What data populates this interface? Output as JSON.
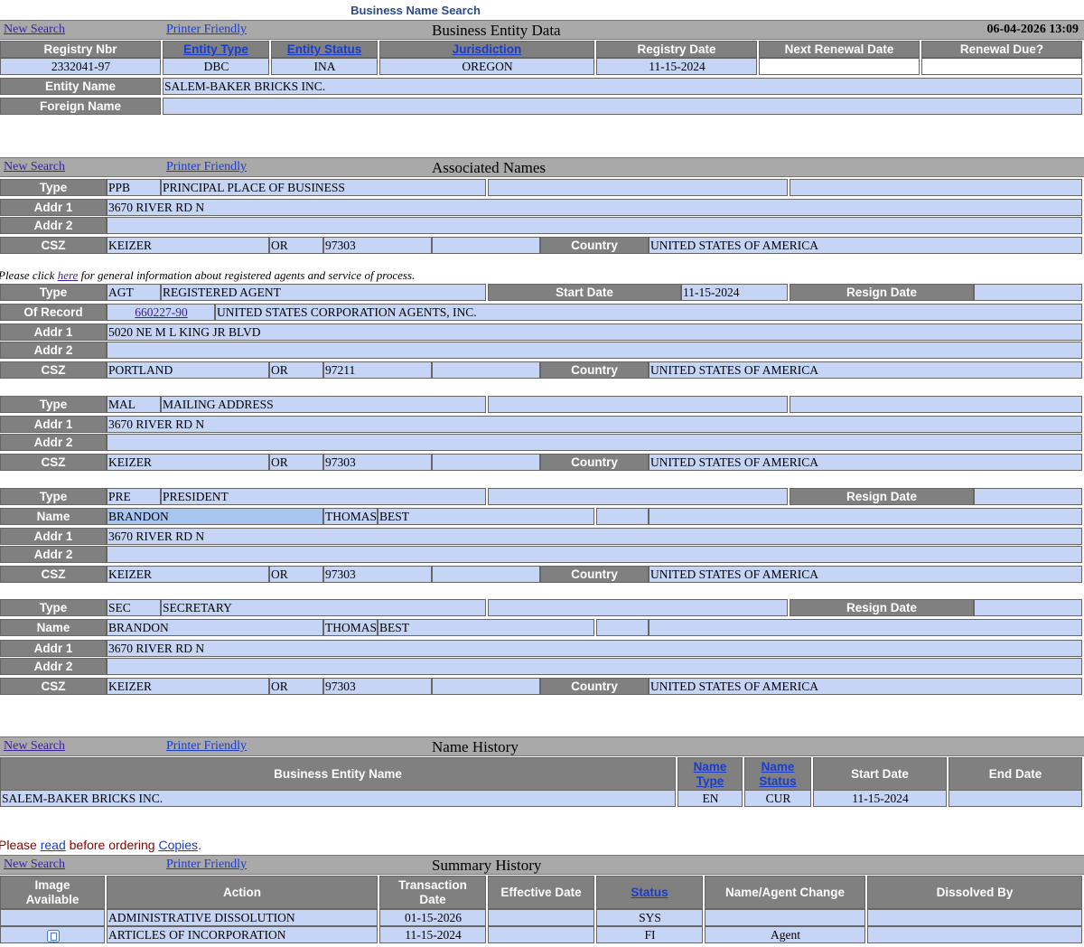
{
  "top_link": "Business Name Search",
  "common": {
    "new_search": "New Search",
    "printer_friendly": "Printer Friendly"
  },
  "entity": {
    "title": "Business Entity Data",
    "timestamp": "06-04-2026 13:09",
    "headers": [
      "Registry Nbr",
      "Entity Type",
      "Entity Status",
      "Jurisdiction",
      "Registry Date",
      "Next Renewal Date",
      "Renewal Due?"
    ],
    "values": [
      "2332041-97",
      "DBC",
      "INA",
      "OREGON",
      "11-15-2024",
      "",
      ""
    ],
    "entity_name_label": "Entity Name",
    "entity_name": "SALEM-BAKER BRICKS INC.",
    "foreign_name_label": "Foreign Name",
    "foreign_name": ""
  },
  "labels": {
    "type": "Type",
    "addr1": "Addr 1",
    "addr2": "Addr 2",
    "csz": "CSZ",
    "country": "Country",
    "of_record": "Of Record",
    "start_date": "Start Date",
    "resign_date": "Resign Date",
    "name": "Name"
  },
  "associated": {
    "title": "Associated Names",
    "ppb": {
      "code": "PPB",
      "desc": "PRINCIPAL PLACE OF BUSINESS",
      "addr1": "3670 RIVER RD N",
      "addr2": "",
      "city": "KEIZER",
      "state": "OR",
      "zip": "97303",
      "country": "UNITED STATES OF AMERICA"
    },
    "agent_note": {
      "pre": "Please click ",
      "link": "here",
      "post": " for general information about registered agents and service of process."
    },
    "agt": {
      "code": "AGT",
      "desc": "REGISTERED AGENT",
      "start_date": "11-15-2024",
      "resign_date": "",
      "record_nbr": "660227-90",
      "record_name": "UNITED STATES CORPORATION AGENTS, INC.",
      "addr1": "5020 NE M L KING JR BLVD",
      "addr2": "",
      "city": "PORTLAND",
      "state": "OR",
      "zip": "97211",
      "country": "UNITED STATES OF AMERICA"
    },
    "mal": {
      "code": "MAL",
      "desc": "MAILING ADDRESS",
      "addr1": "3670 RIVER RD N",
      "addr2": "",
      "city": "KEIZER",
      "state": "OR",
      "zip": "97303",
      "country": "UNITED STATES OF AMERICA"
    },
    "pre": {
      "code": "PRE",
      "desc": "PRESIDENT",
      "first": "BRANDON",
      "middle": "THOMAS",
      "last": "BEST",
      "addr1": "3670 RIVER RD N",
      "addr2": "",
      "city": "KEIZER",
      "state": "OR",
      "zip": "97303",
      "country": "UNITED STATES OF AMERICA"
    },
    "sec": {
      "code": "SEC",
      "desc": "SECRETARY",
      "first": "BRANDON",
      "middle": "THOMAS",
      "last": "BEST",
      "addr1": "3670 RIVER RD N",
      "addr2": "",
      "city": "KEIZER",
      "state": "OR",
      "zip": "97303",
      "country": "UNITED STATES OF AMERICA"
    }
  },
  "name_history": {
    "title": "Name History",
    "headers": [
      "Business Entity Name",
      "Name Type",
      "Name Status",
      "Start Date",
      "End Date"
    ],
    "header_name_type": [
      "Name",
      "Type"
    ],
    "header_name_status": [
      "Name",
      "Status"
    ],
    "rows": [
      {
        "name": "SALEM-BAKER BRICKS INC.",
        "type": "EN",
        "status": "CUR",
        "start": "11-15-2024",
        "end": ""
      }
    ]
  },
  "copies_note": {
    "pre": "Please ",
    "read": "read",
    "mid": " before ordering ",
    "copies": "Copies",
    "post": "."
  },
  "summary": {
    "title": "Summary History",
    "headers": {
      "image": [
        "Image",
        "Available"
      ],
      "action": "Action",
      "txn": [
        "Transaction",
        "Date"
      ],
      "effective": "Effective Date",
      "status": "Status",
      "change": "Name/Agent Change",
      "dissolved": "Dissolved By"
    },
    "rows": [
      {
        "image": false,
        "action": "ADMINISTRATIVE DISSOLUTION",
        "txn_date": "01-15-2026",
        "effective": "",
        "status": "SYS",
        "change": "",
        "dissolved": ""
      },
      {
        "image": true,
        "image_icon": "document-icon",
        "action": "ARTICLES OF INCORPORATION",
        "txn_date": "11-15-2024",
        "effective": "",
        "status": "FI",
        "change": "Agent",
        "dissolved": ""
      }
    ]
  }
}
